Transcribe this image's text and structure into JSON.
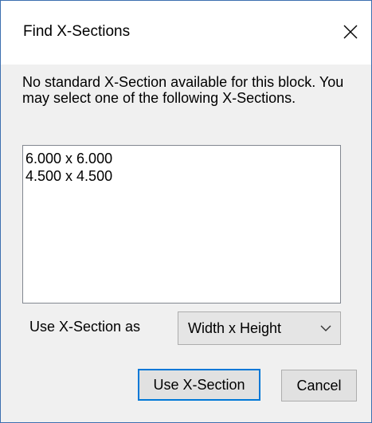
{
  "window": {
    "title": "Find X-Sections",
    "close_icon": "close-icon"
  },
  "message": "No standard X-Section available for this block. You may select one of the following X-Sections.",
  "sections_list": {
    "items": [
      "6.000 x 6.000",
      "4.500 x 4.500"
    ]
  },
  "use_as": {
    "label": "Use X-Section as",
    "selected": "Width x Height",
    "chevron_icon": "chevron-down-icon"
  },
  "buttons": {
    "use_label": "Use X-Section",
    "cancel_label": "Cancel"
  },
  "colors": {
    "accent": "#0078d7",
    "window_border": "#3c6fb0",
    "dialog_background": "#f0f0f0"
  }
}
